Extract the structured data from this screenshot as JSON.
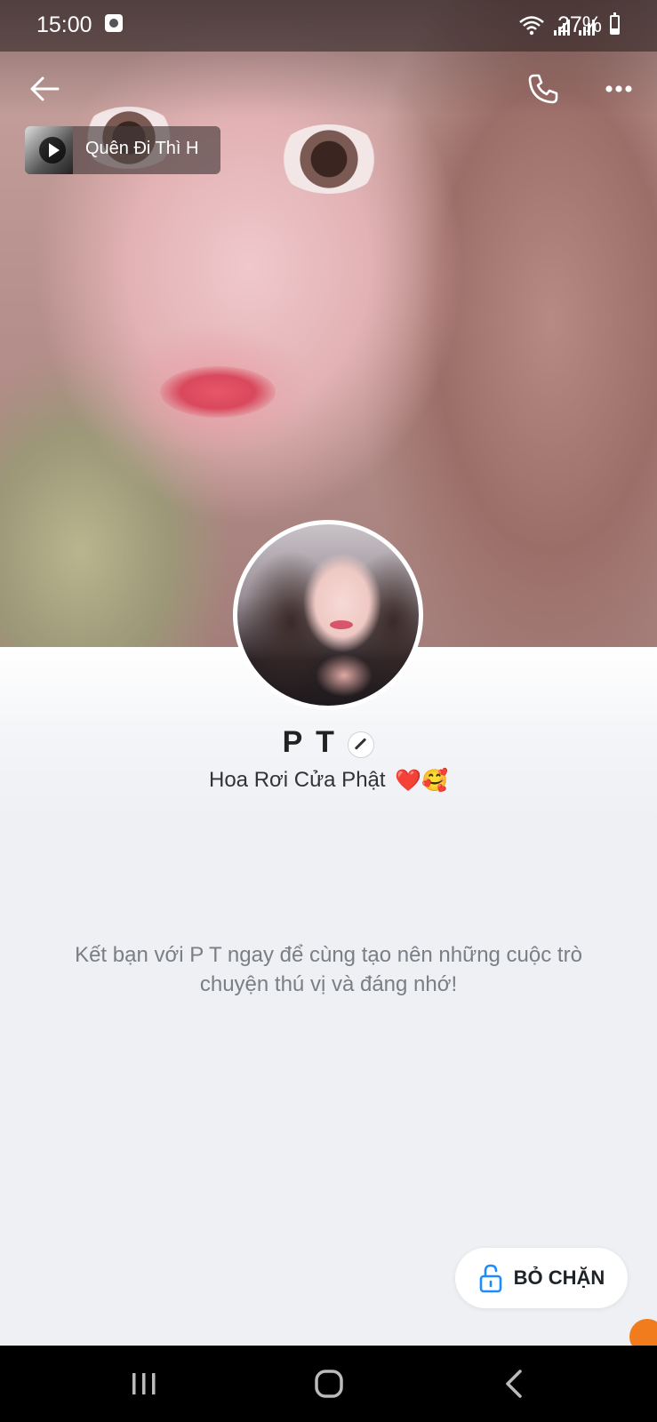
{
  "status_bar": {
    "time": "15:00",
    "battery": "27%"
  },
  "header": {
    "music": {
      "title": "Quên Đi Thì H"
    }
  },
  "profile": {
    "name": "P T",
    "status_text": "Hoa Rơi Cửa Phật",
    "status_emojis": "❤️🥰"
  },
  "invite_text": "Kết bạn với P T ngay để cùng tạo nên những cuộc trò chuyện thú vị và đáng nhớ!",
  "actions": {
    "unblock_label": "BỎ CHẶN"
  },
  "colors": {
    "panel_background": "#eef0f4",
    "unblock_icon": "#1a8cff",
    "float_badge": "#f07c1e"
  }
}
